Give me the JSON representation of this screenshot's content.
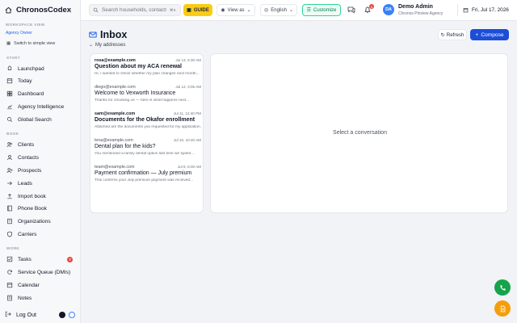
{
  "brand": {
    "name": "ChronosCodex"
  },
  "sidebar": {
    "workspace_label": "WORKSPACE VIEW",
    "workspace_name": "Agency Owner",
    "switch_view": "Switch to simple view",
    "sections": {
      "start": "START",
      "book": "BOOK",
      "work": "WORK"
    },
    "start_items": [
      "Launchpad",
      "Today",
      "Dashboard",
      "Agency Intelligence",
      "Global Search"
    ],
    "book_items": [
      "Clients",
      "Contacts",
      "Prospects",
      "Leads",
      "Import book",
      "Phone Book",
      "Organizations",
      "Carriers"
    ],
    "work_items": [
      {
        "label": "Tasks",
        "badge": "7"
      },
      {
        "label": "Service Queue (DMIs)"
      },
      {
        "label": "Calendar"
      },
      {
        "label": "Notes"
      }
    ],
    "logout": "Log Out"
  },
  "topbar": {
    "search_placeholder": "Search households, contacts",
    "search_shortcut": "⌘K",
    "guide": "GUIDE",
    "view_as": "View as",
    "language": "English",
    "customize": "Customize",
    "notifications_count": "5",
    "user": {
      "initials": "DA",
      "name": "Demo Admin",
      "org": "Chronos Pinview Agency"
    },
    "date": "Fri, Jul 17, 2026"
  },
  "inbox": {
    "title": "Inbox",
    "my_addresses": "My addresses",
    "refresh": "Refresh",
    "compose": "Compose",
    "empty_detail": "Select a conversation",
    "messages": [
      {
        "from": "rosa@example.com",
        "time": "Jul 13, 6:30 AM",
        "subject": "Question about my ACA renewal",
        "preview": "Hi, I wanted to check whether my plan changes next month...",
        "unread": true
      },
      {
        "from": "diego@example.com",
        "time": "Jul 12, 3:05 AM",
        "subject": "Welcome to Vexworth Insurance",
        "preview": "Thanks for choosing us — here is what happens next...",
        "unread": false
      },
      {
        "from": "sam@example.com",
        "time": "Jul 11, 12:40 PM",
        "subject": "Documents for the Okafor enrollment",
        "preview": "Attached are the documents you requested for my application...",
        "unread": true
      },
      {
        "from": "lena@example.com",
        "time": "Jul 10, 10:20 AM",
        "subject": "Dental plan for the kids?",
        "preview": "You mentioned a family dental option last time we spoke...",
        "unread": false
      },
      {
        "from": "team@example.com",
        "time": "Jul 9, 6:00 AM",
        "subject": "Payment confirmation — July premium",
        "preview": "This confirms your July premium payment was received...",
        "unread": false
      }
    ]
  },
  "colors": {
    "accent": "#1d4ed8",
    "guide": "#facc15",
    "customize": "#047857",
    "fab_phone": "#16a34a",
    "fab_notes": "#f59e0b",
    "badge": "#ef4444"
  },
  "icons": {
    "brand": "house-icon",
    "phone_fab": "phone-icon",
    "notes_fab": "document-icon"
  }
}
